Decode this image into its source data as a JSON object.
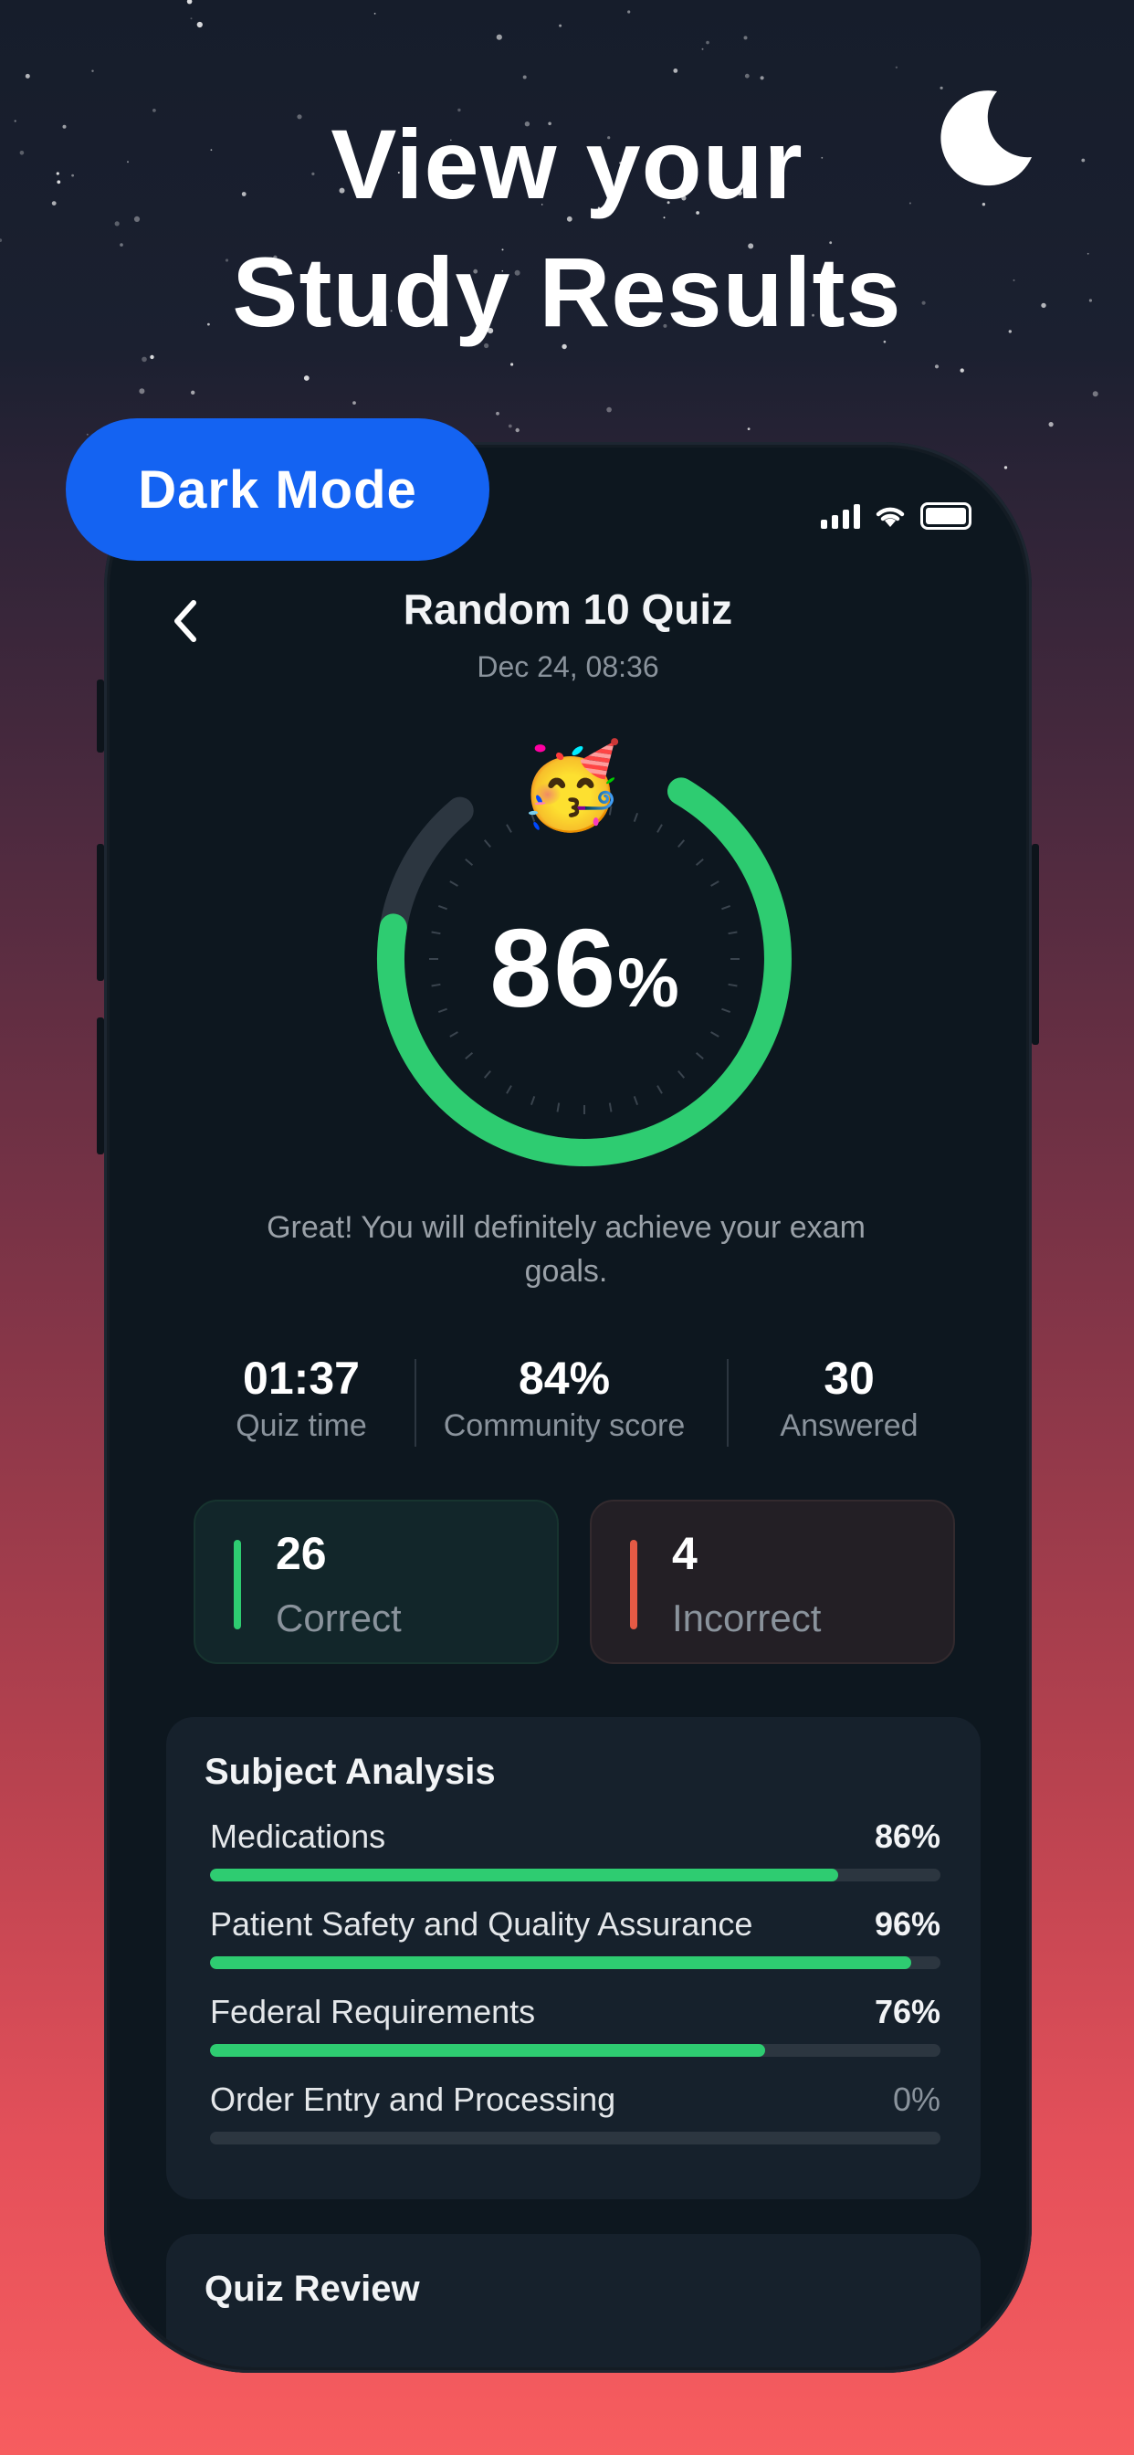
{
  "promo": {
    "headline_line1": "View your",
    "headline_line2": "Study Results",
    "badge_label": "Dark Mode",
    "moon_icon": "crescent-moon-icon"
  },
  "nav": {
    "title": "Random 10 Quiz",
    "date": "Dec 24, 08:36",
    "back_icon": "chevron-left-icon"
  },
  "result": {
    "score_value": "86",
    "score_unit": "%",
    "score_fraction": 0.86,
    "emoji": "🥳",
    "message": "Great! You will definitely achieve your exam goals."
  },
  "stats": [
    {
      "value": "01:37",
      "label": "Quiz time"
    },
    {
      "value": "84%",
      "label": "Community score"
    },
    {
      "value": "30",
      "label": "Answered"
    }
  ],
  "answers": {
    "correct_count": "26",
    "correct_label": "Correct",
    "incorrect_count": "4",
    "incorrect_label": "Incorrect"
  },
  "subject_analysis": {
    "title": "Subject Analysis",
    "items": [
      {
        "name": "Medications",
        "value_label": "86%",
        "fraction": 0.86
      },
      {
        "name": "Patient Safety and Quality Assurance",
        "value_label": "96%",
        "fraction": 0.96
      },
      {
        "name": "Federal Requirements",
        "value_label": "76%",
        "fraction": 0.76
      },
      {
        "name": "Order Entry and Processing",
        "value_label": "0%",
        "fraction": 0
      }
    ]
  },
  "quiz_review": {
    "title": "Quiz Review"
  },
  "colors": {
    "accent_green": "#2ecc71",
    "incorrect_red": "#e55a45",
    "badge_blue": "#1463f2",
    "ring_track": "#2c3640"
  }
}
